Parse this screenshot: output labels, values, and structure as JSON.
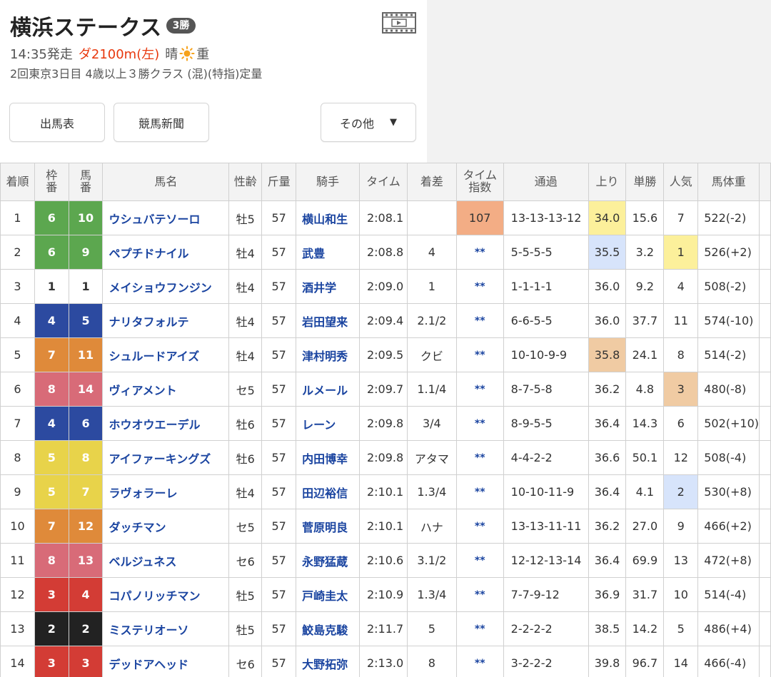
{
  "race": {
    "title": "横浜ステークス",
    "grade": "3勝",
    "start_time": "14:35発走",
    "course": "ダ2100m(左)",
    "weather": "晴",
    "weather_icon": "sun-icon",
    "track_condition": "重",
    "detail": "2回東京3日目 4歳以上３勝クラス (混)(特指)定量"
  },
  "nav": {
    "shutsuba_label": "出馬表",
    "shinbun_label": "競馬新聞",
    "other_label": "その他",
    "other_caret": "▼"
  },
  "colors": {
    "frame": {
      "1": "#ffffff",
      "2": "#222222",
      "3": "#d33c35",
      "4": "#2c4aa0",
      "5": "#e8d34a",
      "6": "#5ca74f",
      "7": "#df8a3a",
      "8": "#d86b78"
    },
    "highlight_yellow": "#fcf09b",
    "highlight_blue": "#d7e4fb",
    "highlight_orange": "#f0cba3",
    "highlight_salmon": "#f3ad85"
  },
  "table": {
    "headers": {
      "rank": "着順",
      "frame_top": "枠",
      "frame_bottom": "番",
      "num_top": "馬",
      "num_bottom": "番",
      "name": "馬名",
      "sexage": "性齢",
      "weight": "斤量",
      "jockey": "騎手",
      "time": "タイム",
      "margin": "着差",
      "tidx_top": "タイム",
      "tidx_bottom": "指数",
      "passing": "通過",
      "last3f": "上り",
      "odds": "単勝",
      "pop": "人気",
      "bodyweight": "馬体重"
    },
    "rows": [
      {
        "rank": "1",
        "frame": "6",
        "num": "10",
        "name": "ウシュバテソーロ",
        "sexage": "牡5",
        "weight": "57",
        "jockey": "横山和生",
        "time": "2:08.1",
        "margin": "",
        "tidx": "107",
        "passing": "13-13-13-12",
        "last3f": "34.0",
        "odds": "15.6",
        "pop": "7",
        "bodyweight": "522(-2)"
      },
      {
        "rank": "2",
        "frame": "6",
        "num": "9",
        "name": "ペプチドナイル",
        "sexage": "牡4",
        "weight": "57",
        "jockey": "武豊",
        "time": "2:08.8",
        "margin": "4",
        "tidx": "**",
        "passing": "5-5-5-5",
        "last3f": "35.5",
        "odds": "3.2",
        "pop": "1",
        "bodyweight": "526(+2)"
      },
      {
        "rank": "3",
        "frame": "1",
        "num": "1",
        "name": "メイショウフンジン",
        "sexage": "牡4",
        "weight": "57",
        "jockey": "酒井学",
        "time": "2:09.0",
        "margin": "1",
        "tidx": "**",
        "passing": "1-1-1-1",
        "last3f": "36.0",
        "odds": "9.2",
        "pop": "4",
        "bodyweight": "508(-2)"
      },
      {
        "rank": "4",
        "frame": "4",
        "num": "5",
        "name": "ナリタフォルテ",
        "sexage": "牡4",
        "weight": "57",
        "jockey": "岩田望来",
        "time": "2:09.4",
        "margin": "2.1/2",
        "tidx": "**",
        "passing": "6-6-5-5",
        "last3f": "36.0",
        "odds": "37.7",
        "pop": "11",
        "bodyweight": "574(-10)"
      },
      {
        "rank": "5",
        "frame": "7",
        "num": "11",
        "name": "シュルードアイズ",
        "sexage": "牡4",
        "weight": "57",
        "jockey": "津村明秀",
        "time": "2:09.5",
        "margin": "クビ",
        "tidx": "**",
        "passing": "10-10-9-9",
        "last3f": "35.8",
        "odds": "24.1",
        "pop": "8",
        "bodyweight": "514(-2)"
      },
      {
        "rank": "6",
        "frame": "8",
        "num": "14",
        "name": "ヴィアメント",
        "sexage": "セ5",
        "weight": "57",
        "jockey": "ルメール",
        "time": "2:09.7",
        "margin": "1.1/4",
        "tidx": "**",
        "passing": "8-7-5-8",
        "last3f": "36.2",
        "odds": "4.8",
        "pop": "3",
        "bodyweight": "480(-8)"
      },
      {
        "rank": "7",
        "frame": "4",
        "num": "6",
        "name": "ホウオウエーデル",
        "sexage": "牡6",
        "weight": "57",
        "jockey": "レーン",
        "time": "2:09.8",
        "margin": "3/4",
        "tidx": "**",
        "passing": "8-9-5-5",
        "last3f": "36.4",
        "odds": "14.3",
        "pop": "6",
        "bodyweight": "502(+10)"
      },
      {
        "rank": "8",
        "frame": "5",
        "num": "8",
        "name": "アイファーキングズ",
        "sexage": "牡6",
        "weight": "57",
        "jockey": "内田博幸",
        "time": "2:09.8",
        "margin": "アタマ",
        "tidx": "**",
        "passing": "4-4-2-2",
        "last3f": "36.6",
        "odds": "50.1",
        "pop": "12",
        "bodyweight": "508(-4)"
      },
      {
        "rank": "9",
        "frame": "5",
        "num": "7",
        "name": "ラヴォラーレ",
        "sexage": "牡4",
        "weight": "57",
        "jockey": "田辺裕信",
        "time": "2:10.1",
        "margin": "1.3/4",
        "tidx": "**",
        "passing": "10-10-11-9",
        "last3f": "36.4",
        "odds": "4.1",
        "pop": "2",
        "bodyweight": "530(+8)"
      },
      {
        "rank": "10",
        "frame": "7",
        "num": "12",
        "name": "ダッチマン",
        "sexage": "セ5",
        "weight": "57",
        "jockey": "菅原明良",
        "time": "2:10.1",
        "margin": "ハナ",
        "tidx": "**",
        "passing": "13-13-11-11",
        "last3f": "36.2",
        "odds": "27.0",
        "pop": "9",
        "bodyweight": "466(+2)"
      },
      {
        "rank": "11",
        "frame": "8",
        "num": "13",
        "name": "ベルジュネス",
        "sexage": "セ6",
        "weight": "57",
        "jockey": "永野猛蔵",
        "time": "2:10.6",
        "margin": "3.1/2",
        "tidx": "**",
        "passing": "12-12-13-14",
        "last3f": "36.4",
        "odds": "69.9",
        "pop": "13",
        "bodyweight": "472(+8)"
      },
      {
        "rank": "12",
        "frame": "3",
        "num": "4",
        "name": "コパノリッチマン",
        "sexage": "牡5",
        "weight": "57",
        "jockey": "戸崎圭太",
        "time": "2:10.9",
        "margin": "1.3/4",
        "tidx": "**",
        "passing": "7-7-9-12",
        "last3f": "36.9",
        "odds": "31.7",
        "pop": "10",
        "bodyweight": "514(-4)"
      },
      {
        "rank": "13",
        "frame": "2",
        "num": "2",
        "name": "ミステリオーソ",
        "sexage": "牡5",
        "weight": "57",
        "jockey": "鮫島克駿",
        "time": "2:11.7",
        "margin": "5",
        "tidx": "**",
        "passing": "2-2-2-2",
        "last3f": "38.5",
        "odds": "14.2",
        "pop": "5",
        "bodyweight": "486(+4)"
      },
      {
        "rank": "14",
        "frame": "3",
        "num": "3",
        "name": "デッドアヘッド",
        "sexage": "セ6",
        "weight": "57",
        "jockey": "大野拓弥",
        "time": "2:13.0",
        "margin": "8",
        "tidx": "**",
        "passing": "3-2-2-2",
        "last3f": "39.8",
        "odds": "96.7",
        "pop": "14",
        "bodyweight": "466(-4)"
      }
    ]
  }
}
